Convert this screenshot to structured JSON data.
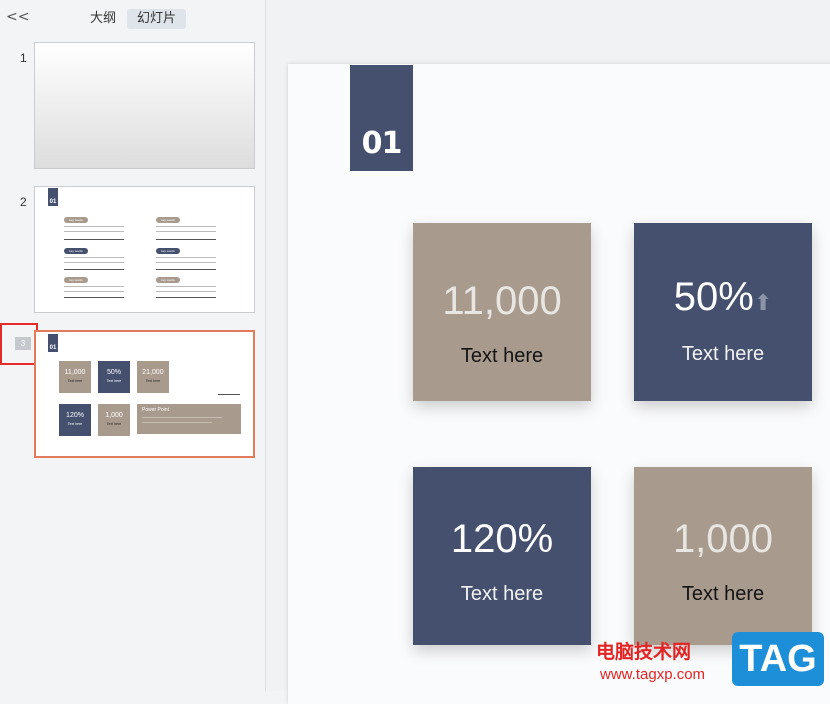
{
  "sidebar": {
    "collapse_glyph": "<<",
    "tabs": [
      {
        "label": "大纲"
      },
      {
        "label": "幻灯片",
        "active": true
      }
    ],
    "slides": [
      {
        "number": "1"
      },
      {
        "number": "2",
        "block_label": "01",
        "pills": [
          "key words",
          "key words",
          "key words",
          "key words",
          "key words",
          "key words"
        ]
      },
      {
        "number": "3",
        "block_label": "01",
        "cards": [
          {
            "value": "11,000",
            "label": "Text here"
          },
          {
            "value": "50%",
            "label": "Text here"
          },
          {
            "value": "21,000",
            "label": "Text here"
          },
          {
            "value": "120%",
            "label": "Text here"
          },
          {
            "value": "1,000",
            "label": "Text here"
          }
        ],
        "panel_title": "Power Point",
        "selected": true
      }
    ]
  },
  "slide": {
    "number_label": "01",
    "cards": [
      {
        "value": "11,000",
        "label": "Text here",
        "color": "#a89b8e"
      },
      {
        "value": "50%",
        "label": "Text here",
        "color": "#44506e",
        "arrow": "⬆"
      },
      {
        "value": "120%",
        "label": "Text here",
        "color": "#44506e"
      },
      {
        "value": "1,000",
        "label": "Text here",
        "color": "#a89b8e"
      }
    ]
  },
  "watermark": {
    "site_name": "电脑技术网",
    "url": "www.tagxp.com",
    "badge": "TAG"
  },
  "colors": {
    "accent_blue": "#44506e",
    "accent_tan": "#a89b8e",
    "selection": "#e27a5c",
    "highlight_box": "#e42b2b"
  }
}
